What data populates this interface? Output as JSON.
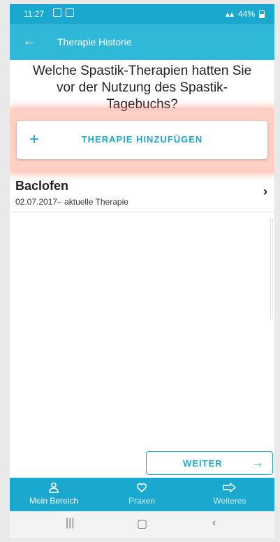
{
  "statusbar": {
    "time": "11:27",
    "battery": "44%"
  },
  "appbar": {
    "title": "Therapie Historie"
  },
  "question": "Welche Spastik-Therapien hatten Sie vor der Nutzung des Spastik-Tagebuchs?",
  "add_therapy": {
    "label": "THERAPIE HINZUFÜGEN"
  },
  "therapies": [
    {
      "name": "Baclofen",
      "period": "02.07.2017– aktuelle Therapie"
    }
  ],
  "next_button": {
    "label": "WEITER"
  },
  "bottom_nav": {
    "items": [
      {
        "label": "Mein Bereich",
        "icon": "person-icon"
      },
      {
        "label": "Praxen",
        "icon": "heart-icon"
      },
      {
        "label": "Weiteres",
        "icon": "arrow-right-outline-icon"
      }
    ]
  },
  "colors": {
    "primary": "#1aa8cf",
    "appbar": "#2fb8d8",
    "highlight": "#ff7a5a"
  }
}
